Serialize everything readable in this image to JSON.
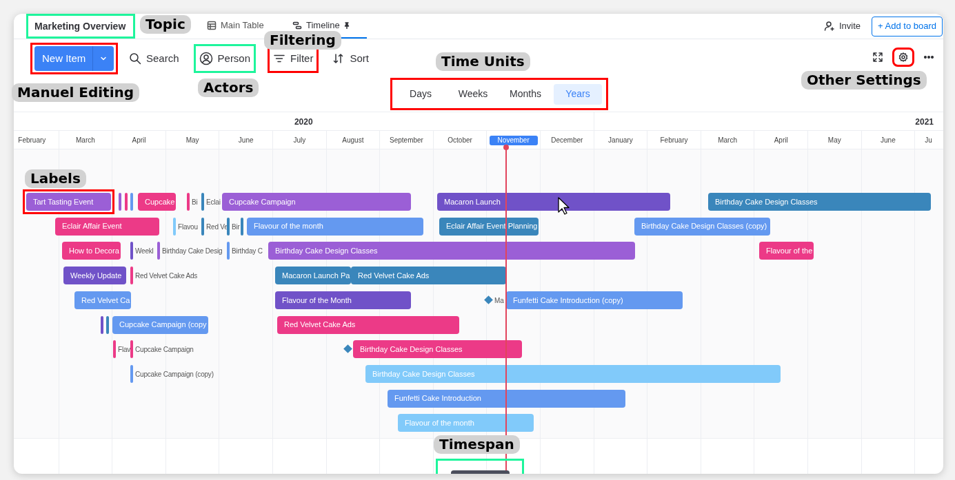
{
  "header": {
    "title": "Marketing Overview",
    "tabs": [
      {
        "label": "Main Table",
        "selected": false,
        "pinned": false
      },
      {
        "label": "Timeline",
        "selected": true,
        "pinned": true
      }
    ],
    "invite": "Invite",
    "add_button": "+ Add to board"
  },
  "toolbar": {
    "new_item": "New Item",
    "buttons": [
      {
        "label": "Search"
      },
      {
        "label": "Person"
      },
      {
        "label": "Filter"
      },
      {
        "label": "Sort"
      }
    ]
  },
  "time_units": [
    {
      "label": "Days",
      "selected": false
    },
    {
      "label": "Weeks",
      "selected": false
    },
    {
      "label": "Months",
      "selected": false
    },
    {
      "label": "Years",
      "selected": true
    }
  ],
  "timeline": {
    "years": [
      {
        "label": "2020",
        "months": [
          {
            "label": "February",
            "selected": false
          },
          {
            "label": "March",
            "selected": false
          },
          {
            "label": "April",
            "selected": false
          },
          {
            "label": "May",
            "selected": false
          },
          {
            "label": "June",
            "selected": false
          },
          {
            "label": "July",
            "selected": false
          },
          {
            "label": "August",
            "selected": false
          },
          {
            "label": "September",
            "selected": false
          },
          {
            "label": "October",
            "selected": false
          },
          {
            "label": "November",
            "selected": true
          },
          {
            "label": "December",
            "selected": false
          }
        ]
      },
      {
        "label": "2021",
        "months": [
          {
            "label": "January",
            "selected": false
          },
          {
            "label": "February",
            "selected": false
          },
          {
            "label": "March",
            "selected": false
          },
          {
            "label": "April",
            "selected": false
          },
          {
            "label": "May",
            "selected": false
          },
          {
            "label": "June",
            "selected": false
          },
          {
            "label": "Ju",
            "selected": false
          }
        ]
      }
    ],
    "rows": [
      {
        "items": [
          {
            "kind": "bar",
            "label": "Tart Tasting Event",
            "color": "#9b5fd6"
          },
          {
            "kind": "marker",
            "color": "#9b5fd6"
          },
          {
            "kind": "marker",
            "color": "#ec3a87"
          },
          {
            "kind": "marker",
            "color": "#6499f0"
          },
          {
            "kind": "bar",
            "label": "Cupcake",
            "color": "#ec3a87"
          },
          {
            "kind": "marker",
            "label": "Bi",
            "color": "#ec3a87"
          },
          {
            "kind": "marker",
            "label": "Eclai",
            "color": "#3a86bb"
          },
          {
            "kind": "bar",
            "label": "Cupcake Campaign",
            "color": "#9b5fd6"
          },
          {
            "kind": "bar",
            "label": "Macaron Launch",
            "color": "#7052c8"
          },
          {
            "kind": "bar",
            "label": "Birthday Cake Design Classes",
            "color": "#3a86bb"
          }
        ]
      },
      {
        "items": [
          {
            "kind": "bar",
            "label": "Eclair Affair Event",
            "color": "#ec3a87"
          },
          {
            "kind": "marker",
            "label": "Flavou",
            "color": "#81cafa"
          },
          {
            "kind": "marker",
            "label": "Red Ve",
            "color": "#3a86bb"
          },
          {
            "kind": "marker",
            "label": "Bir",
            "color": "#3a86bb"
          },
          {
            "kind": "marker",
            "color": "#3a86bb"
          },
          {
            "kind": "bar",
            "label": "Flavour of the month",
            "color": "#6499f0"
          },
          {
            "kind": "bar",
            "label": "Eclair Affair Event Planning",
            "color": "#3a86bb"
          },
          {
            "kind": "bar",
            "label": "Birthday Cake Design Classes (copy)",
            "color": "#6499f0"
          }
        ]
      },
      {
        "items": [
          {
            "kind": "bar",
            "label": "How to Decora",
            "color": "#ec3a87"
          },
          {
            "kind": "marker",
            "label": "Weekl",
            "color": "#7052c8"
          },
          {
            "kind": "marker",
            "label": "Birthday Cake Desig",
            "color": "#9b5fd6"
          },
          {
            "kind": "marker",
            "label": "Birthday C",
            "color": "#6499f0"
          },
          {
            "kind": "bar",
            "label": "Birthday Cake Design Classes",
            "color": "#9b5fd6"
          },
          {
            "kind": "bar",
            "label": "Flavour of the",
            "color": "#ec3a87"
          }
        ]
      },
      {
        "items": [
          {
            "kind": "bar",
            "label": "Weekly Update",
            "color": "#7052c8"
          },
          {
            "kind": "marker",
            "label": "Red Velvet Cake Ads",
            "color": "#ec3a87"
          },
          {
            "kind": "bar",
            "label": "Macaron Launch Pa",
            "color": "#3a86bb"
          },
          {
            "kind": "bar",
            "label": "Red Velvet Cake Ads",
            "color": "#3a86bb"
          }
        ]
      },
      {
        "items": [
          {
            "kind": "bar",
            "label": "Red Velvet Ca",
            "color": "#6499f0"
          },
          {
            "kind": "bar",
            "label": "Flavour of the Month",
            "color": "#7052c8"
          },
          {
            "kind": "diamond",
            "label": "Ma",
            "color": "#3a86bb"
          },
          {
            "kind": "bar",
            "label": "Funfetti Cake Introduction (copy)",
            "color": "#6499f0"
          }
        ]
      },
      {
        "items": [
          {
            "kind": "marker",
            "color": "#7052c8"
          },
          {
            "kind": "marker",
            "color": "#3a86bb"
          },
          {
            "kind": "bar",
            "label": "Cupcake Campaign (copy",
            "color": "#6499f0"
          },
          {
            "kind": "bar",
            "label": "Red Velvet Cake Ads",
            "color": "#ec3a87"
          }
        ]
      },
      {
        "items": [
          {
            "kind": "marker",
            "label": "Flav",
            "color": "#ec3a87"
          },
          {
            "kind": "marker",
            "label": "Cupcake Campaign",
            "color": "#ec3a87"
          },
          {
            "kind": "diamond",
            "color": "#3a86bb"
          },
          {
            "kind": "bar",
            "label": "Birthday Cake Design Classes",
            "color": "#ec3a87"
          }
        ]
      },
      {
        "items": [
          {
            "kind": "marker",
            "label": "Cupcake Campaign (copy)",
            "color": "#6499f0"
          },
          {
            "kind": "bar",
            "label": "Birthday Cake Design Classes",
            "color": "#81cafa"
          }
        ]
      },
      {
        "items": [
          {
            "kind": "bar",
            "label": "Funfetti Cake Introduction",
            "color": "#6499f0"
          }
        ]
      },
      {
        "items": [
          {
            "kind": "bar",
            "label": "Flavour of the month",
            "color": "#81cafa"
          }
        ]
      }
    ]
  },
  "annotation_frames": [
    {
      "color": "#1ef59c"
    },
    {
      "color": "#ff0000"
    },
    {
      "color": "#1ef59c"
    },
    {
      "color": "#ff0000"
    },
    {
      "color": "#ff0000"
    },
    {
      "color": "#ff0000"
    },
    {
      "color": "#ff0000"
    },
    {
      "color": "#1ef59c"
    }
  ],
  "callouts": [
    {
      "text": "Topic"
    },
    {
      "text": "Filtering"
    },
    {
      "text": "Time Units"
    },
    {
      "text": "Other Settings"
    },
    {
      "text": "Actors"
    },
    {
      "text": "Manuel Editing"
    },
    {
      "text": "Labels"
    },
    {
      "text": "Timespan"
    }
  ]
}
